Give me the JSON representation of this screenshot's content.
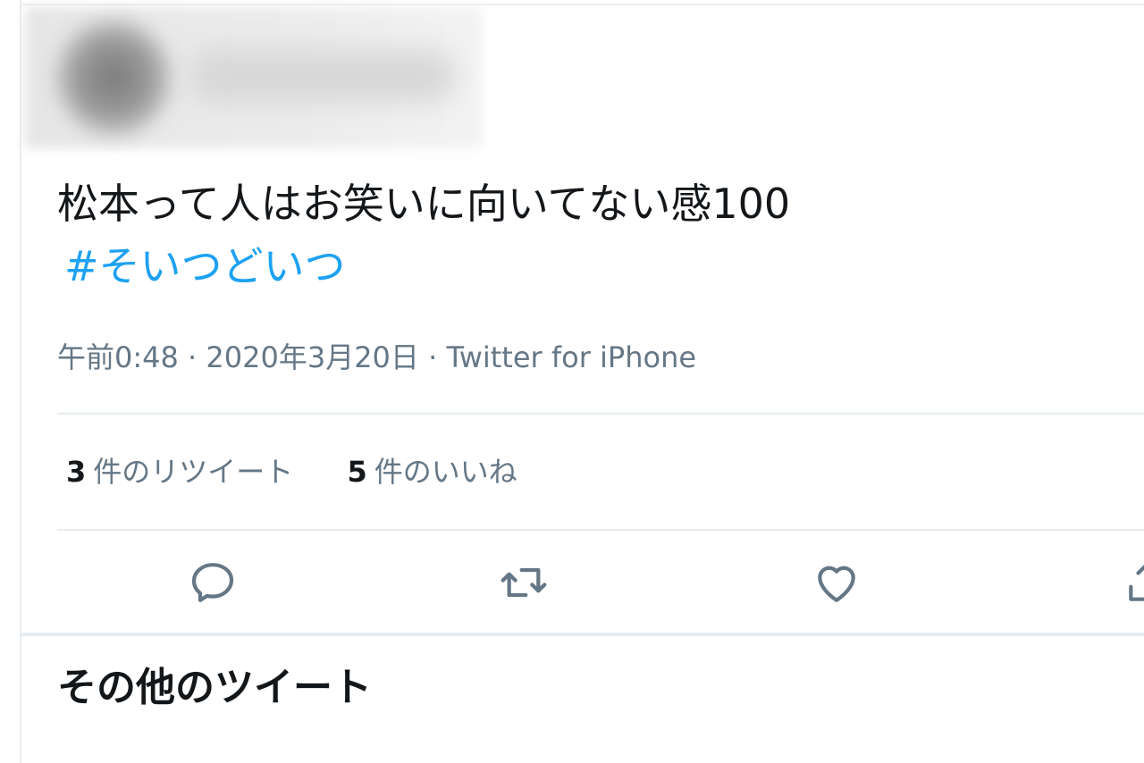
{
  "tweet": {
    "text": "松本って人はお笑いに向いてない感100",
    "hashtag": "#そいつどいつ",
    "time": "午前0:48",
    "separator": "·",
    "date": "2020年3月20日",
    "source": "Twitter for iPhone"
  },
  "stats": {
    "retweets_count": "3",
    "retweets_label": "件のリツイート",
    "likes_count": "5",
    "likes_label": "件のいいね"
  },
  "actions": {
    "reply_icon": "speech-bubble",
    "retweet_icon": "retweet-arrows",
    "like_icon": "heart-outline",
    "share_icon": "share-upload"
  },
  "more_tweets": {
    "title": "その他のツイート"
  },
  "colors": {
    "text": "#14171a",
    "secondary": "#657786",
    "hashtag": "#1da1f2",
    "divider": "#e6ecf0"
  }
}
